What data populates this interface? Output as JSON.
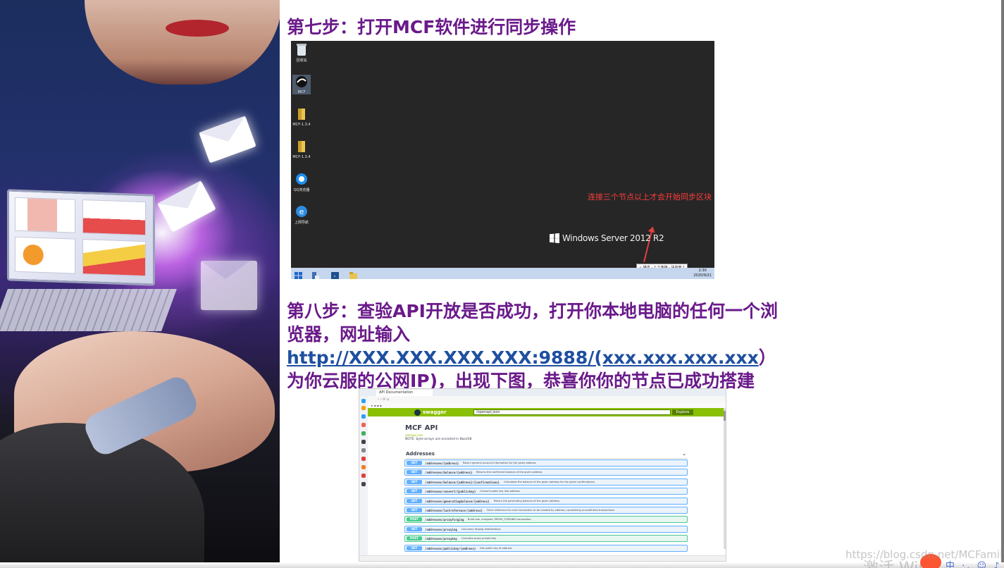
{
  "step7": {
    "title": "第七步：打开MCF软件进行同步操作"
  },
  "desktop": {
    "icons": [
      {
        "label": "回收站",
        "icon": "recycle-bin-icon"
      },
      {
        "label": "MCF",
        "icon": "mcf-app-icon"
      },
      {
        "label": "MCF-1.3.4",
        "icon": "folder-icon"
      },
      {
        "label": "MCF-1.3.4",
        "icon": "folder-icon"
      },
      {
        "label": "QQ浏览器",
        "icon": "qq-browser-icon"
      },
      {
        "label": "上网导航",
        "icon": "ie-browser-icon"
      }
    ],
    "annotation": "连接三个节点以上才会开始同步区块",
    "os_label": "Windows Server 2012 R2",
    "tray_balloon": "✓ 播币 - 2 个连接 - 块高度 1",
    "time": "2:30",
    "date": "2020/9/21"
  },
  "step8": {
    "text1": "第八步：查验API开放是否成功，打开你本地电脑的任何一个浏览器，网址输入",
    "url": "http://XXX.XXX.XXX.XXX:9888/(xxx.xxx.xxx.xxx",
    "text2": "）为你云服的公网IP)，出现下图，恭喜你你的节点已成功搭建"
  },
  "browser": {
    "tab_title": "API Documentation",
    "logo": "swagger",
    "url_value": "/openapi.json",
    "explore_label": "Explore",
    "api_title": "MCF API",
    "api_sub": "openapi.json",
    "note": "NOTE: byte-arrays are encoded in Base58",
    "section": "Addresses",
    "operations": [
      {
        "method": "GET",
        "path": "/addresses/{address}",
        "desc": "Return general account information for the given address"
      },
      {
        "method": "GET",
        "path": "/addresses/balance/{address}",
        "desc": "Returns the confirmed balance of the given address"
      },
      {
        "method": "GET",
        "path": "/addresses/balance/{address}/{confirmations}",
        "desc": "Calculates the balance of the given address for the given confirmations"
      },
      {
        "method": "GET",
        "path": "/addresses/convert/{publickey}",
        "desc": "Convert public key into address"
      },
      {
        "method": "GET",
        "path": "/addresses/generatingbalance/{address}",
        "desc": "Return the generating balance of the given address"
      },
      {
        "method": "GET",
        "path": "/addresses/lastreference/{address}",
        "desc": "Fetch reference for next transaction to be created by address, considering unconfirmed transactions"
      },
      {
        "method": "POST",
        "path": "/addresses/proxyforging",
        "desc": "Build raw, unsigned, PROXY_FORGING transaction"
      },
      {
        "method": "GET",
        "path": "/addresses/proxying",
        "desc": "List proxy forging relationships"
      },
      {
        "method": "POST",
        "path": "/addresses/proxykey",
        "desc": "Calculate proxy private key"
      },
      {
        "method": "GET",
        "path": "/addresses/publickey/{address}",
        "desc": "Get public key of address"
      }
    ]
  },
  "watermark": "https://blog.csdn.net/MCFamily",
  "activate": "激活 Win"
}
